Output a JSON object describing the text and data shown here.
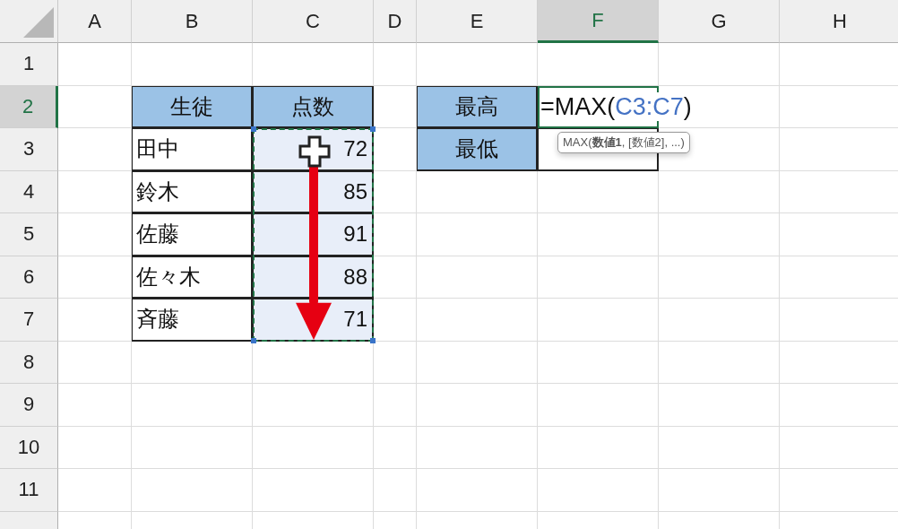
{
  "column_headers": [
    {
      "label": "A",
      "selected": false
    },
    {
      "label": "B",
      "selected": false
    },
    {
      "label": "C",
      "selected": false
    },
    {
      "label": "D",
      "selected": false
    },
    {
      "label": "E",
      "selected": false
    },
    {
      "label": "F",
      "selected": true
    },
    {
      "label": "G",
      "selected": false
    },
    {
      "label": "H",
      "selected": false
    }
  ],
  "row_headers": [
    {
      "label": "1",
      "selected": false
    },
    {
      "label": "2",
      "selected": true
    },
    {
      "label": "3",
      "selected": false
    },
    {
      "label": "4",
      "selected": false
    },
    {
      "label": "5",
      "selected": false
    },
    {
      "label": "6",
      "selected": false
    },
    {
      "label": "7",
      "selected": false
    },
    {
      "label": "8",
      "selected": false
    },
    {
      "label": "9",
      "selected": false
    },
    {
      "label": "10",
      "selected": false
    },
    {
      "label": "11",
      "selected": false
    }
  ],
  "score_table": {
    "headers": [
      "生徒",
      "点数"
    ],
    "rows": [
      {
        "name": "田中",
        "score": "72",
        "selected": true
      },
      {
        "name": "鈴木",
        "score": "85",
        "selected": true
      },
      {
        "name": "佐藤",
        "score": "91",
        "selected": true
      },
      {
        "name": "佐々木",
        "score": "88",
        "selected": true
      },
      {
        "name": "斉藤",
        "score": "71",
        "selected": true
      }
    ]
  },
  "summary_table": {
    "rows": [
      {
        "label": "最高",
        "editing": true,
        "formula": {
          "prefix": "=MAX(",
          "reference": "C3:C7",
          "suffix": ")"
        }
      },
      {
        "label": "最低",
        "editing": false
      }
    ]
  },
  "tooltip": "MAX(**数値1**, [数値2], ...)"
}
